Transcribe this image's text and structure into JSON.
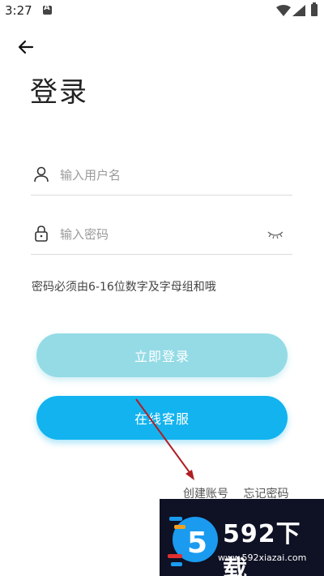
{
  "status_bar": {
    "time": "3:27",
    "icons": [
      "notification-a-icon",
      "wifi-icon",
      "signal-icon",
      "battery-charging-icon"
    ]
  },
  "header": {
    "back_icon": "arrow-left-icon",
    "title": "登录"
  },
  "form": {
    "username": {
      "placeholder": "输入用户名",
      "value": "",
      "icon": "user-icon"
    },
    "password": {
      "placeholder": "输入密码",
      "value": "",
      "icon": "lock-icon",
      "toggle_icon": "eye-closed-icon"
    },
    "hint": "密码必须由6-16位数字及字母组和哦"
  },
  "buttons": {
    "login_label": "立即登录",
    "service_label": "在线客服"
  },
  "links": {
    "create_account": "创建账号",
    "forgot_password": "忘记密码"
  },
  "watermark": {
    "brand": "592下载",
    "url": "www.592xiazai.com"
  },
  "colors": {
    "login_button": "#94dbe6",
    "service_button": "#12b3ef",
    "annotation_arrow": "#b01e23",
    "watermark_bg": "#0f1124"
  }
}
